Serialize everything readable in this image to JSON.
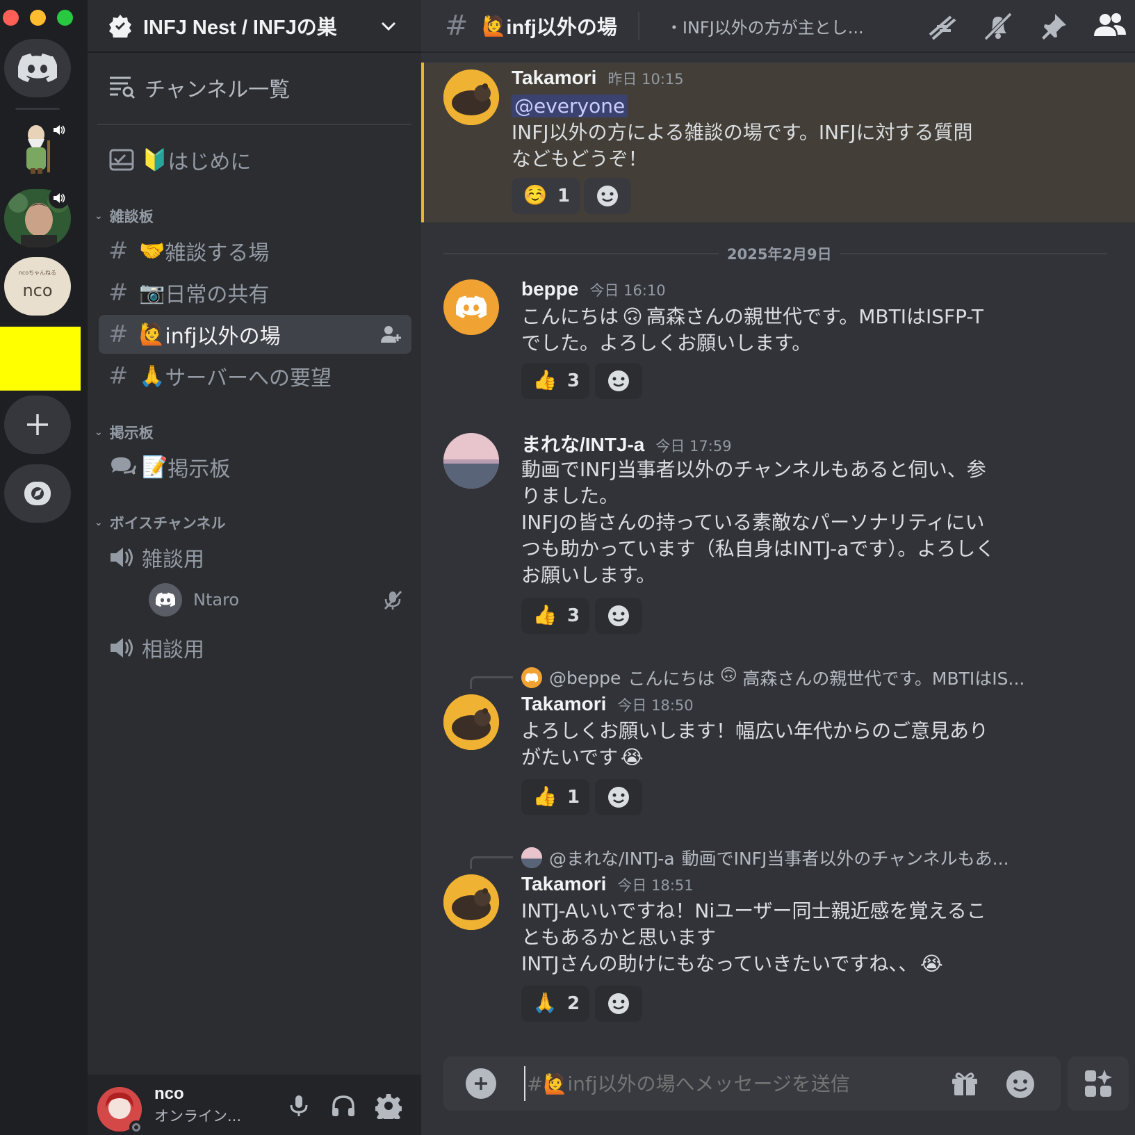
{
  "window": {
    "traffic_lights": [
      "#ff5f57",
      "#febc2e",
      "#28c840"
    ]
  },
  "rail": {
    "home_icon": "discord-logo-icon",
    "servers": [
      {
        "name": "wizard-server",
        "speaker": true
      },
      {
        "name": "photo-server",
        "speaker": true
      },
      {
        "name": "nco-server",
        "label": "nco",
        "sub": "ncoちゃんねる"
      },
      {
        "name": "yellow-server"
      }
    ],
    "add_icon": "plus-icon",
    "discover_icon": "compass-icon"
  },
  "guild": {
    "name": "INFJ Nest / INFJの巣"
  },
  "sidebar": {
    "browse_label": "チャンネル一覧",
    "welcome": {
      "emoji": "🔰",
      "label": "はじめに"
    },
    "categories": [
      {
        "label": "雑談板"
      },
      {
        "label": "掲示板"
      },
      {
        "label": "ボイスチャンネル"
      }
    ],
    "text_channels": [
      {
        "emoji": "🤝",
        "label": "雑談する場"
      },
      {
        "emoji": "📷",
        "label": "日常の共有"
      },
      {
        "emoji": "🙋",
        "label": "infj以外の場"
      },
      {
        "emoji": "🙏",
        "label": "サーバーへの要望"
      }
    ],
    "forum": {
      "emoji": "📝",
      "label": "掲示板"
    },
    "voice": [
      {
        "label": "雑談用"
      },
      {
        "label": "相談用"
      }
    ],
    "voice_user": {
      "name": "Ntaro"
    }
  },
  "user_panel": {
    "name": "nco",
    "status": "オンライン..."
  },
  "header": {
    "channel_emoji": "🙋",
    "channel_name": "infj以外の場",
    "topic": "・INFJ以外の方が主とし..."
  },
  "messages": {
    "m1": {
      "author": "Takamori",
      "time": "昨日 10:15",
      "mention": "@everyone",
      "line1": "INFJ以外の方による雑談の場です。INFJに対する質問",
      "line2": "などもどうぞ！",
      "reaction": {
        "emoji": "☺️",
        "count": "1"
      }
    },
    "date_divider": "2025年2月9日",
    "m2": {
      "author": "beppe",
      "time": "今日 16:10",
      "line1a": "こんにちは",
      "line1b": "高森さんの親世代です。MBTIはISFP-T",
      "line2": "でした。よろしくお願いします。",
      "reaction": {
        "emoji": "👍",
        "count": "3"
      }
    },
    "m3": {
      "author": "まれな/INTJ-a",
      "time": "今日 17:59",
      "lines": [
        "動画でINFJ当事者以外のチャンネルもあると伺い、参",
        "りました。",
        "INFJの皆さんの持っている素敵なパーソナリティにい",
        "つも助かっています（私自身はINTJ-aです）。よろしく",
        "お願いします。"
      ],
      "reaction": {
        "emoji": "👍",
        "count": "3"
      }
    },
    "m4": {
      "reply_author": "@beppe",
      "reply_text_a": "こんにちは",
      "reply_text_b": "高森さんの親世代です。MBTIはIS...",
      "author": "Takamori",
      "time": "今日 18:50",
      "line1": "よろしくお願いします！幅広い年代からのご意見あり",
      "line2": "がたいです",
      "reaction": {
        "emoji": "👍",
        "count": "1"
      }
    },
    "m5": {
      "reply_author": "@まれな/INTJ-a",
      "reply_text": "動画でINFJ当事者以外のチャンネルもあ...",
      "author": "Takamori",
      "time": "今日 18:51",
      "line1": "INTJ-Aいいですね！Niユーザー同士親近感を覚えるこ",
      "line2": "ともあるかと思います",
      "line3": "INTJさんの助けにもなっていきたいですね、、",
      "reaction": {
        "emoji": "🙏",
        "count": "2"
      }
    }
  },
  "composer": {
    "placeholder": "#🙋infj以外の場へメッセージを送信"
  },
  "colors": {
    "accent": "#5865f2",
    "mention_bg": "#4a4a3a",
    "highlight_bar": "#f0b232"
  }
}
